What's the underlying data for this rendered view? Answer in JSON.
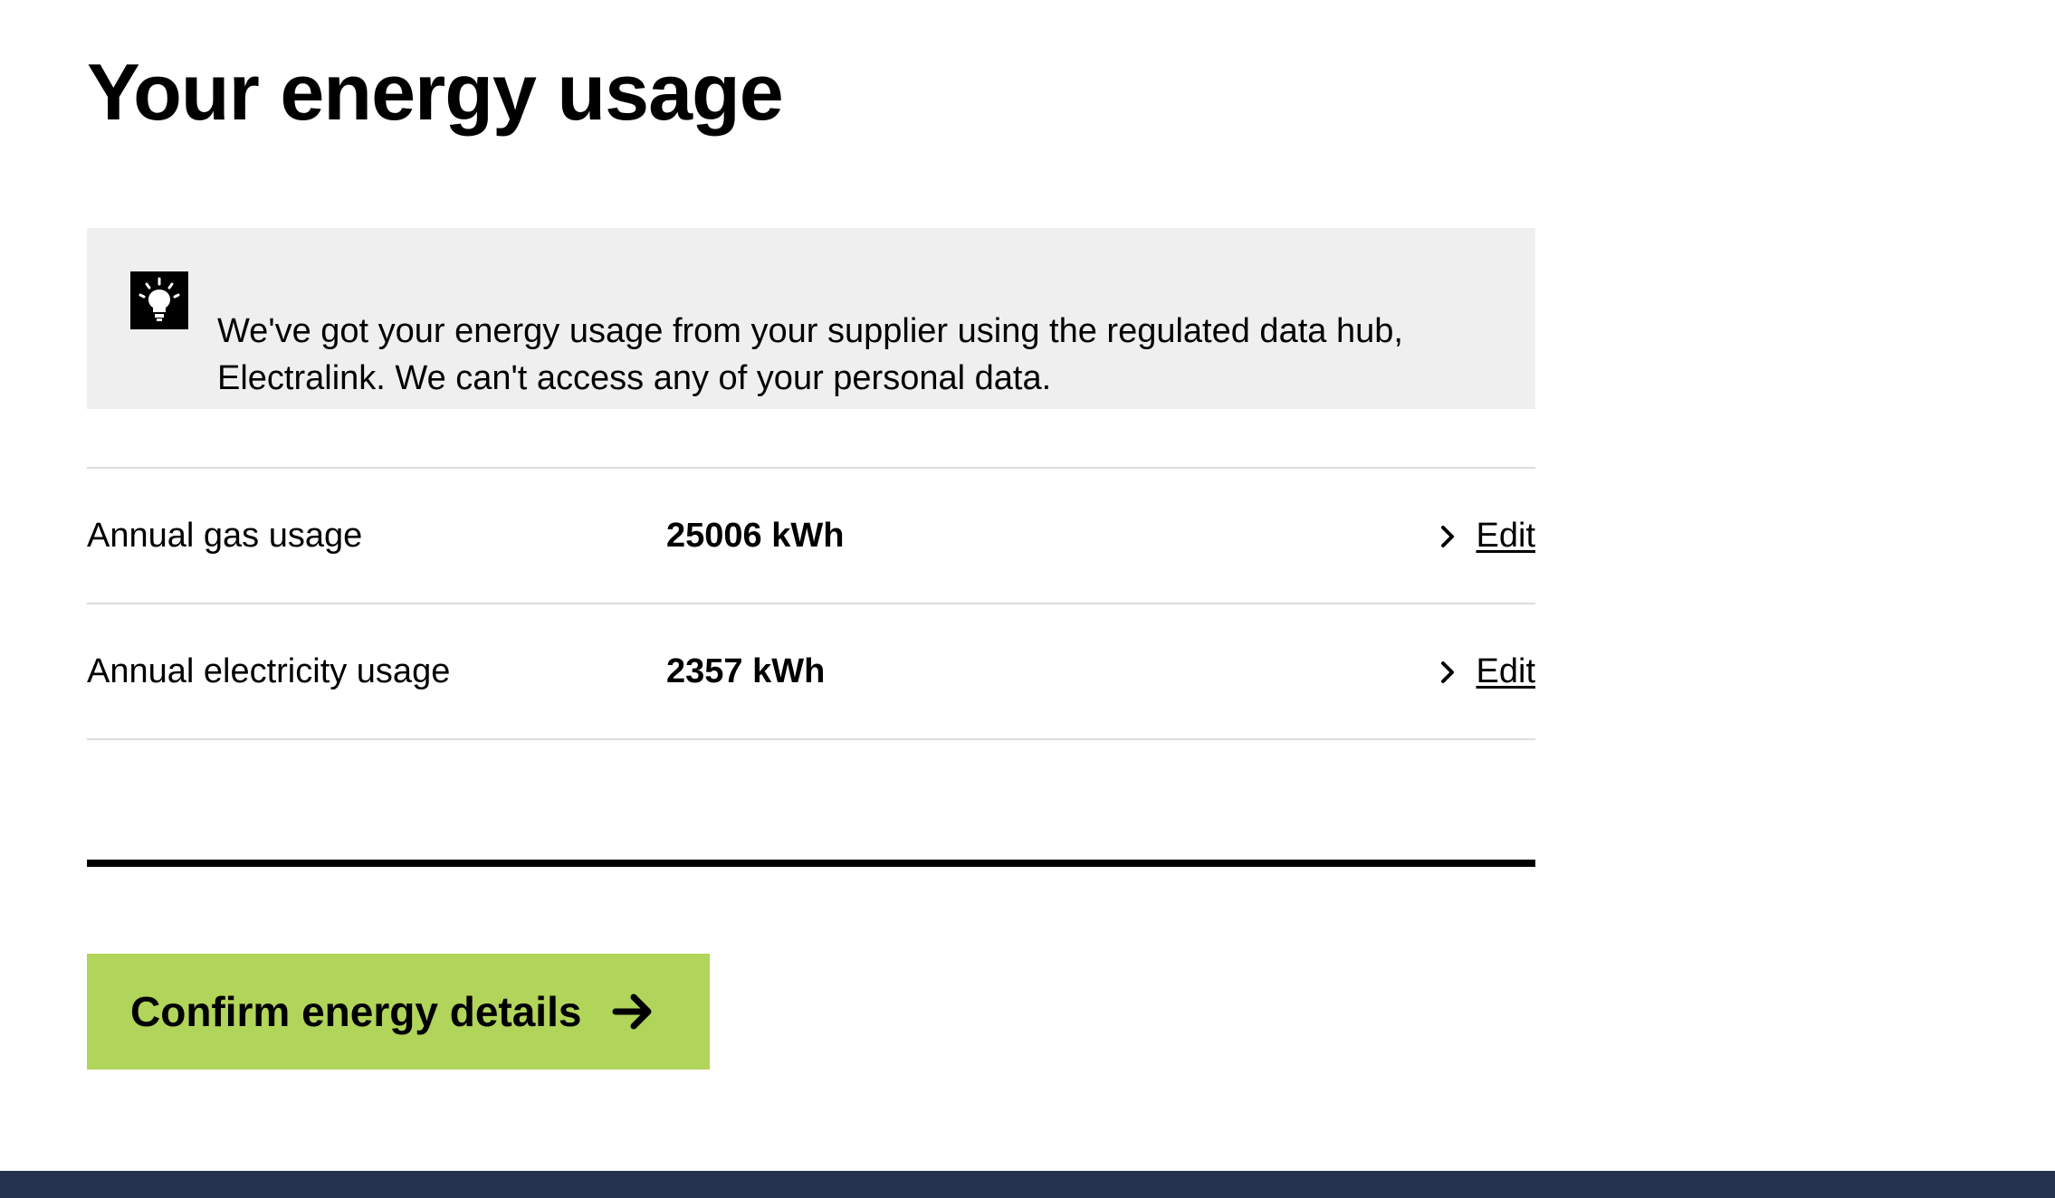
{
  "page": {
    "title": "Your energy usage"
  },
  "info_box": {
    "icon": "lightbulb-icon",
    "text": "We've got your energy usage from your supplier using the regulated data hub, Electralink. We can't access any of your personal data."
  },
  "usage": {
    "rows": [
      {
        "label": "Annual gas usage",
        "value": "25006 kWh",
        "edit_label": "Edit",
        "edit_icon": "chevron-right-icon"
      },
      {
        "label": "Annual electricity usage",
        "value": "2357 kWh",
        "edit_label": "Edit",
        "edit_icon": "chevron-right-icon"
      }
    ]
  },
  "actions": {
    "confirm_label": "Confirm energy details",
    "confirm_icon": "arrow-right-icon"
  },
  "colors": {
    "info_background": "#efefef",
    "button_background": "#b1d45a",
    "footer_background": "#24314f",
    "divider": "#dddddd",
    "text": "#000000"
  }
}
